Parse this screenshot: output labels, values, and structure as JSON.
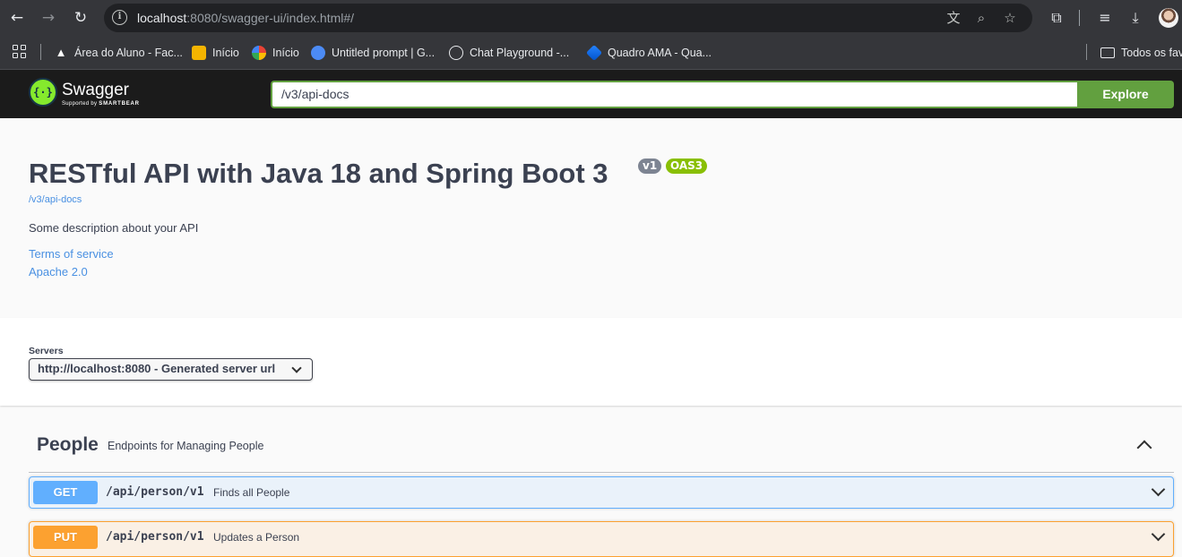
{
  "browser": {
    "url_host": "localhost",
    "url_rest": ":8080/swagger-ui/index.html#/",
    "bookmarks": [
      {
        "label": "Área do Aluno - Fac..."
      },
      {
        "label": "Início"
      },
      {
        "label": "Início"
      },
      {
        "label": "Untitled prompt | G..."
      },
      {
        "label": "Chat Playground -..."
      },
      {
        "label": "Quadro AMA - Qua..."
      }
    ],
    "bookmarks_folder": "Todos os fav"
  },
  "swagger": {
    "logo_text": "Swagger",
    "logo_sub_prefix": "Supported by",
    "logo_sub_brand": "SMARTBEAR",
    "url_value": "/v3/api-docs",
    "explore_label": "Explore"
  },
  "info": {
    "title": "RESTful API with Java 18 and Spring Boot 3",
    "version_badge": "v1",
    "oas_badge": "OAS3",
    "api_link": "/v3/api-docs",
    "description": "Some description about your API",
    "terms_link": "Terms of service",
    "license_link": "Apache 2.0"
  },
  "servers": {
    "label": "Servers",
    "selected": "http://localhost:8080 - Generated server url"
  },
  "tag": {
    "name": "People",
    "description": "Endpoints for Managing People"
  },
  "operations": [
    {
      "method": "GET",
      "path": "/api/person/v1",
      "summary": "Finds all People"
    },
    {
      "method": "PUT",
      "path": "/api/person/v1",
      "summary": "Updates a Person"
    }
  ],
  "colors": {
    "swagger_green": "#62a03f",
    "get_blue": "#61affe",
    "put_orange": "#fca130",
    "oas_green": "#89bf04",
    "topbar_bg": "#1b1b1b"
  }
}
